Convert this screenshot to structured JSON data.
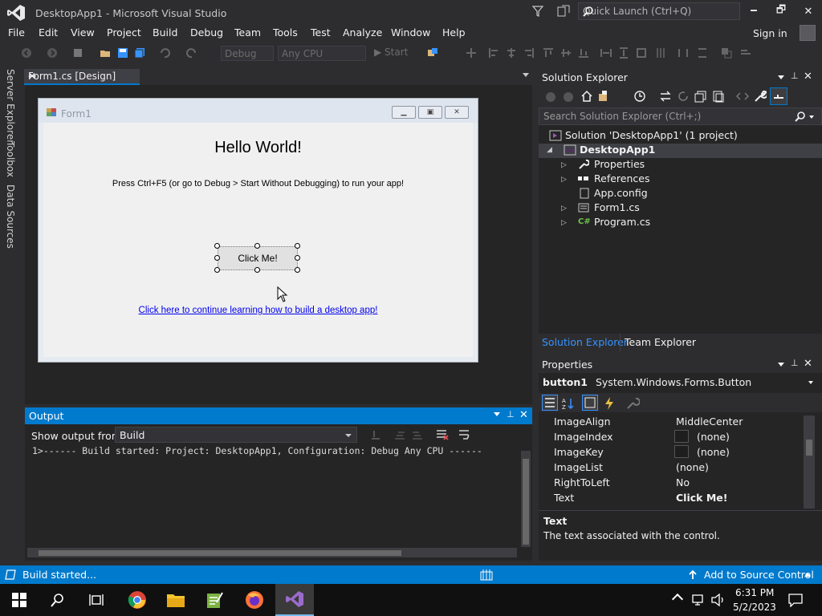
{
  "window": {
    "title": "DesktopApp1 - Microsoft Visual Studio",
    "quick_launch_placeholder": "Quick Launch (Ctrl+Q)",
    "minimize": "🗕",
    "maximize": "🗗",
    "close": "✕"
  },
  "menu": {
    "items": [
      "File",
      "Edit",
      "View",
      "Project",
      "Build",
      "Debug",
      "Team",
      "Tools",
      "Test",
      "Analyze",
      "Window",
      "Help"
    ],
    "signin": "Sign in"
  },
  "toolbar": {
    "config": "Debug",
    "platform": "Any CPU",
    "start": "Start"
  },
  "document_tab": {
    "label": "Form1.cs [Design]",
    "pin": "⊸",
    "close": "✕"
  },
  "side_tabs": [
    "Server Explorer",
    "Toolbox",
    "Data Sources"
  ],
  "form": {
    "title": "Form1",
    "heading": "Hello World!",
    "instruction": "Press Ctrl+F5 (or go to Debug > Start Without Debugging) to run your app!",
    "button_label": "Click Me!",
    "link": "Click here to continue learning how to build a desktop app!"
  },
  "output": {
    "title": "Output",
    "show_from_label": "Show output from:",
    "source": "Build",
    "lines": [
      "1>------ Build started: Project: DesktopApp1, Configuration: Debug Any CPU ------"
    ]
  },
  "solution_explorer": {
    "title": "Solution Explorer",
    "search_placeholder": "Search Solution Explorer (Ctrl+;)",
    "solution": "Solution 'DesktopApp1' (1 project)",
    "project": "DesktopApp1",
    "items": [
      "Properties",
      "References",
      "App.config",
      "Form1.cs",
      "Program.cs"
    ],
    "tabs": [
      "Solution Explorer",
      "Team Explorer"
    ]
  },
  "properties": {
    "title": "Properties",
    "object_name": "button1",
    "object_type": "System.Windows.Forms.Button",
    "rows": [
      {
        "name": "ImageAlign",
        "value": "MiddleCenter"
      },
      {
        "name": "ImageIndex",
        "value": "(none)"
      },
      {
        "name": "ImageKey",
        "value": "(none)"
      },
      {
        "name": "ImageList",
        "value": "(none)"
      },
      {
        "name": "RightToLeft",
        "value": "No"
      },
      {
        "name": "Text",
        "value": "Click Me!"
      }
    ],
    "desc_title": "Text",
    "desc_text": "The text associated with the control."
  },
  "status": {
    "message": "Build started...",
    "source_control": "Add to Source Control"
  },
  "taskbar": {
    "time": "6:31 PM",
    "date": "5/2/2023"
  },
  "colors": {
    "accent": "#007acc",
    "background": "#2d2d30",
    "panel": "#252526"
  }
}
